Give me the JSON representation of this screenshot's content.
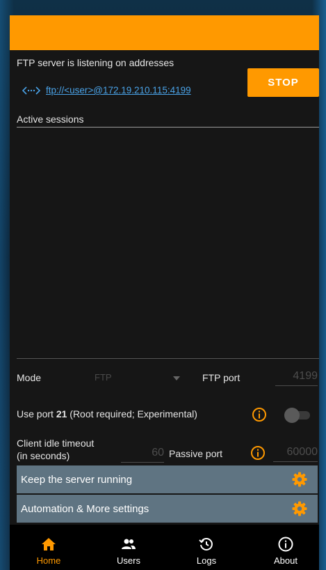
{
  "status": {
    "listening_text": "FTP server is listening on addresses",
    "address_link": "ftp://<user>@172.19.210.115:4199",
    "stop_label": "STOP"
  },
  "sessions": {
    "label": "Active sessions"
  },
  "settings": {
    "mode_label": "Mode",
    "mode_value": "FTP",
    "ftp_port_label": "FTP port",
    "ftp_port_value": "4199",
    "use_port_prefix": "Use port ",
    "use_port_number": "21",
    "use_port_suffix": " (Root required; Experimental)",
    "use_port_enabled": false,
    "idle_label_line1": "Client idle timeout",
    "idle_label_line2": "(in seconds)",
    "idle_value": "60",
    "passive_port_label": "Passive port",
    "passive_port_value": "60000"
  },
  "cards": [
    {
      "label": "Keep the server running",
      "icon": "gear-icon"
    },
    {
      "label": "Automation & More settings",
      "icon": "gear-icon"
    }
  ],
  "nav": [
    {
      "label": "Home",
      "icon": "home-icon",
      "active": true
    },
    {
      "label": "Users",
      "icon": "users-icon",
      "active": false
    },
    {
      "label": "Logs",
      "icon": "history-icon",
      "active": false
    },
    {
      "label": "About",
      "icon": "info-icon",
      "active": false
    }
  ],
  "colors": {
    "accent": "#ff9900",
    "link": "#4aa3e8",
    "card": "#5f7482",
    "background": "#161616"
  }
}
